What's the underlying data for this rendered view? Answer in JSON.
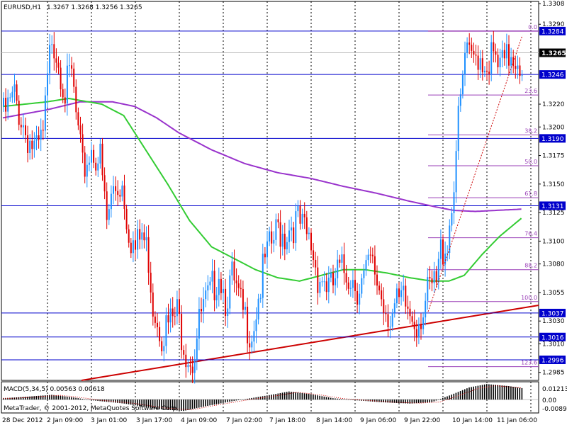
{
  "header": {
    "symbol": "EURUSD,H1",
    "ohlc": "1.3267 1.3268 1.3256 1.3265"
  },
  "macd": {
    "label": "MACD(5,34,5) 0.00563 0.00618",
    "ticks": [
      "0.01213",
      "0.00",
      "-0.00892"
    ]
  },
  "copyright": "MetaTrader, © 2001-2012, MetaQuotes Software Corp.",
  "colors": {
    "bull": "#1e90ff",
    "bear": "#e00000",
    "ma_fast": "#33cc33",
    "ma_slow": "#9933cc",
    "hline": "#0000cc",
    "trend": "#cc0000",
    "fib": "#9a3fb7",
    "grid": "#000000",
    "current_tag": "#000000",
    "level_tag": "#0000cc"
  },
  "chart_data": {
    "type": "candlestick",
    "symbol": "EURUSD",
    "timeframe": "H1",
    "ylim": [
      1.2978,
      1.331
    ],
    "y_ticks": [
      "1.3308",
      "1.3290",
      "1.3265",
      "1.3246",
      "1.3220",
      "1.3200",
      "1.3175",
      "1.3150",
      "1.3125",
      "1.3100",
      "1.3080",
      "1.3055",
      "1.3030",
      "1.3010",
      "1.2985"
    ],
    "x_ticks": [
      "28 Dec 2012",
      "2 Jan 09:00",
      "3 Jan 01:00",
      "3 Jan 17:00",
      "4 Jan 09:00",
      "7 Jan 02:00",
      "7 Jan 18:00",
      "8 Jan 14:00",
      "9 Jan 06:00",
      "9 Jan 22:00",
      "10 Jan 14:00",
      "11 Jan 06:00"
    ],
    "current_price": "1.3265",
    "horizontal_levels": [
      "1.3284",
      "1.3246",
      "1.3190",
      "1.3131",
      "1.3037",
      "1.3016",
      "1.2996"
    ],
    "fibonacci": [
      {
        "label": "0.0",
        "price": 1.3284
      },
      {
        "label": "23.6",
        "price": 1.3228
      },
      {
        "label": "38.2",
        "price": 1.3193
      },
      {
        "label": "50.0",
        "price": 1.3166
      },
      {
        "label": "61.8",
        "price": 1.3138
      },
      {
        "label": "76.4",
        "price": 1.3103
      },
      {
        "label": "88.2",
        "price": 1.3075
      },
      {
        "label": "100.0",
        "price": 1.3047
      },
      {
        "label": "123.6",
        "price": 1.299
      }
    ],
    "path_anchors": [
      [
        0,
        1.3218
      ],
      [
        5,
        1.3235
      ],
      [
        10,
        1.3205
      ],
      [
        15,
        1.3185
      ],
      [
        18,
        1.32
      ],
      [
        22,
        1.3292
      ],
      [
        25,
        1.327
      ],
      [
        28,
        1.324
      ],
      [
        31,
        1.3255
      ],
      [
        34,
        1.32
      ],
      [
        36,
        1.317
      ],
      [
        40,
        1.319
      ],
      [
        44,
        1.318
      ],
      [
        47,
        1.3125
      ],
      [
        50,
        1.3155
      ],
      [
        54,
        1.316
      ],
      [
        57,
        1.312
      ],
      [
        60,
        1.31
      ],
      [
        63,
        1.3115
      ],
      [
        66,
        1.3095
      ],
      [
        68,
        1.3055
      ],
      [
        72,
        1.303
      ],
      [
        75,
        1.3035
      ],
      [
        79,
        1.3045
      ],
      [
        83,
        1.3015
      ],
      [
        86,
        1.3005
      ],
      [
        90,
        1.3045
      ],
      [
        94,
        1.306
      ],
      [
        98,
        1.3085
      ],
      [
        101,
        1.306
      ],
      [
        104,
        1.3075
      ],
      [
        107,
        1.3055
      ],
      [
        110,
        1.304
      ],
      [
        113,
        1.303
      ],
      [
        116,
        1.306
      ],
      [
        119,
        1.309
      ],
      [
        122,
        1.3105
      ],
      [
        125,
        1.312
      ],
      [
        128,
        1.3115
      ],
      [
        131,
        1.3125
      ],
      [
        134,
        1.3125
      ],
      [
        137,
        1.3115
      ],
      [
        140,
        1.3105
      ],
      [
        143,
        1.308
      ],
      [
        146,
        1.3075
      ],
      [
        149,
        1.3065
      ],
      [
        152,
        1.308
      ],
      [
        155,
        1.3082
      ],
      [
        158,
        1.308
      ],
      [
        161,
        1.307
      ],
      [
        164,
        1.3075
      ],
      [
        167,
        1.3088
      ],
      [
        170,
        1.3075
      ],
      [
        173,
        1.3055
      ],
      [
        176,
        1.3045
      ],
      [
        179,
        1.305
      ],
      [
        182,
        1.3055
      ],
      [
        185,
        1.3045
      ],
      [
        188,
        1.304
      ],
      [
        191,
        1.305
      ],
      [
        194,
        1.3065
      ],
      [
        197,
        1.307
      ],
      [
        199,
        1.31
      ],
      [
        202,
        1.311
      ],
      [
        204,
        1.314
      ],
      [
        206,
        1.319
      ],
      [
        208,
        1.323
      ],
      [
        210,
        1.327
      ],
      [
        213,
        1.3265
      ],
      [
        216,
        1.3275
      ],
      [
        219,
        1.3265
      ],
      [
        222,
        1.327
      ],
      [
        225,
        1.326
      ],
      [
        228,
        1.3262
      ],
      [
        231,
        1.3275
      ],
      [
        234,
        1.327
      ],
      [
        236,
        1.3265
      ]
    ],
    "ma_fast_anchors": [
      [
        0,
        1.3218
      ],
      [
        20,
        1.3222
      ],
      [
        30,
        1.3225
      ],
      [
        45,
        1.322
      ],
      [
        55,
        1.321
      ],
      [
        65,
        1.318
      ],
      [
        75,
        1.315
      ],
      [
        85,
        1.3118
      ],
      [
        95,
        1.3095
      ],
      [
        105,
        1.3085
      ],
      [
        115,
        1.3075
      ],
      [
        125,
        1.3068
      ],
      [
        135,
        1.3065
      ],
      [
        145,
        1.307
      ],
      [
        155,
        1.3075
      ],
      [
        165,
        1.3075
      ],
      [
        175,
        1.3072
      ],
      [
        185,
        1.3068
      ],
      [
        195,
        1.3065
      ],
      [
        203,
        1.3065
      ],
      [
        210,
        1.307
      ],
      [
        218,
        1.3088
      ],
      [
        226,
        1.3104
      ],
      [
        236,
        1.312
      ]
    ],
    "ma_slow_anchors": [
      [
        0,
        1.3208
      ],
      [
        20,
        1.3215
      ],
      [
        35,
        1.3222
      ],
      [
        50,
        1.3222
      ],
      [
        60,
        1.3218
      ],
      [
        70,
        1.3208
      ],
      [
        80,
        1.3195
      ],
      [
        95,
        1.318
      ],
      [
        110,
        1.3168
      ],
      [
        125,
        1.316
      ],
      [
        140,
        1.3155
      ],
      [
        155,
        1.3148
      ],
      [
        170,
        1.3142
      ],
      [
        185,
        1.3135
      ],
      [
        197,
        1.313
      ],
      [
        205,
        1.3127
      ],
      [
        215,
        1.3126
      ],
      [
        225,
        1.3127
      ],
      [
        236,
        1.3128
      ]
    ],
    "macd_hist_anchors": [
      [
        0,
        0.001
      ],
      [
        10,
        0.002
      ],
      [
        22,
        0.0035
      ],
      [
        30,
        0.002
      ],
      [
        40,
        -0.0005
      ],
      [
        55,
        -0.003
      ],
      [
        70,
        -0.007
      ],
      [
        82,
        -0.0085
      ],
      [
        92,
        -0.005
      ],
      [
        105,
        -0.001
      ],
      [
        120,
        0.003
      ],
      [
        130,
        0.006
      ],
      [
        140,
        0.004
      ],
      [
        150,
        0.001
      ],
      [
        160,
        -0.0005
      ],
      [
        172,
        -0.002
      ],
      [
        185,
        -0.003
      ],
      [
        195,
        -0.002
      ],
      [
        203,
        0.003
      ],
      [
        212,
        0.009
      ],
      [
        220,
        0.0115
      ],
      [
        230,
        0.01
      ],
      [
        236,
        0.0085
      ]
    ]
  }
}
